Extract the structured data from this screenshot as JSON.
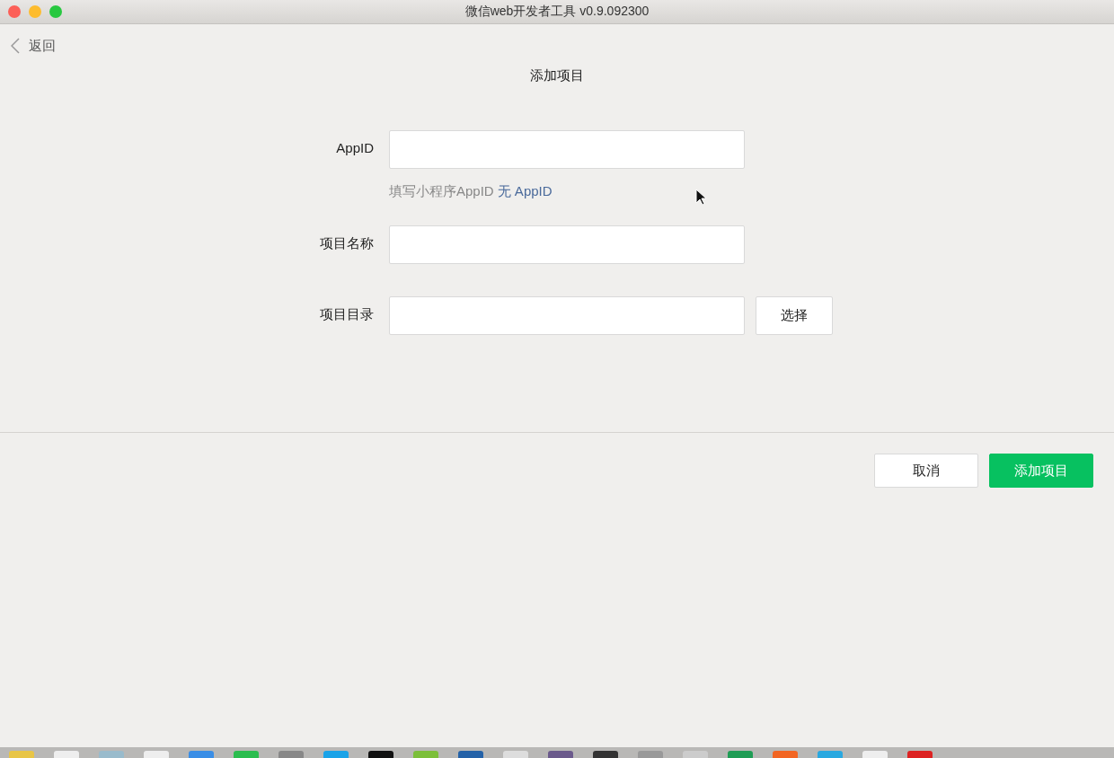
{
  "window": {
    "title": "微信web开发者工具 v0.9.092300"
  },
  "back": {
    "label": "返回"
  },
  "page_title": "添加项目",
  "fields": [
    {
      "kind": "hint",
      "label": "AppID",
      "hint": "填写小程序AppID",
      "link": "无 AppID"
    },
    {
      "kind": "plain",
      "label": "项目名称"
    },
    {
      "kind": "button",
      "label": "项目目录",
      "button": "选择"
    }
  ],
  "actions": [
    {
      "kind": "secondary",
      "label": "取消"
    },
    {
      "kind": "primary",
      "label": "添加项目"
    }
  ]
}
